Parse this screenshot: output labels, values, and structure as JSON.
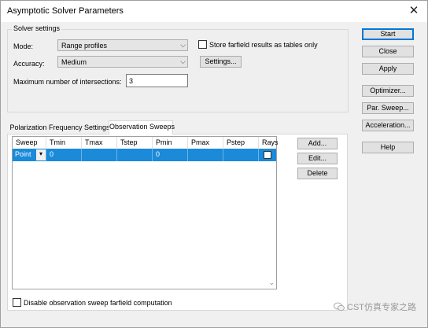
{
  "window": {
    "title": "Asymptotic Solver Parameters",
    "close_glyph": "✕"
  },
  "solver_settings": {
    "legend": "Solver settings",
    "mode_label": "Mode:",
    "mode_value": "Range profiles",
    "accuracy_label": "Accuracy:",
    "accuracy_value": "Medium",
    "max_intersections_label": "Maximum number of intersections:",
    "max_intersections_value": "3",
    "store_farfield_label": "Store farfield results as tables only",
    "store_farfield_checked": false,
    "settings_button": "Settings..."
  },
  "right_buttons": {
    "start": "Start",
    "close": "Close",
    "apply": "Apply",
    "optimizer": "Optimizer...",
    "par_sweep": "Par. Sweep...",
    "acceleration": "Acceleration...",
    "help": "Help"
  },
  "tabs": [
    "Polarization",
    "Frequency Settings",
    "Observation Sweeps"
  ],
  "active_tab": "Observation Sweeps",
  "sweep_table": {
    "columns": [
      "Sweep",
      "Tmin",
      "Tmax",
      "Tstep",
      "Pmin",
      "Pmax",
      "Pstep",
      "Rays"
    ],
    "rows": [
      {
        "sweep": "Point",
        "tmin": "0",
        "tmax": "",
        "tstep": "",
        "pmin": "0",
        "pmax": "",
        "pstep": "",
        "rays": false
      }
    ]
  },
  "table_buttons": {
    "add": "Add...",
    "edit": "Edit...",
    "delete": "Delete"
  },
  "disable_sweep_label": "Disable observation sweep farfield computation",
  "disable_sweep_checked": false,
  "watermark": "CST仿真专家之路",
  "icons": {
    "close": "close-icon",
    "dropdown": "chevron-down-icon",
    "wechat": "wechat-icon"
  },
  "colors": {
    "selection": "#1a8ad9",
    "default_button_border": "#0078d7"
  }
}
